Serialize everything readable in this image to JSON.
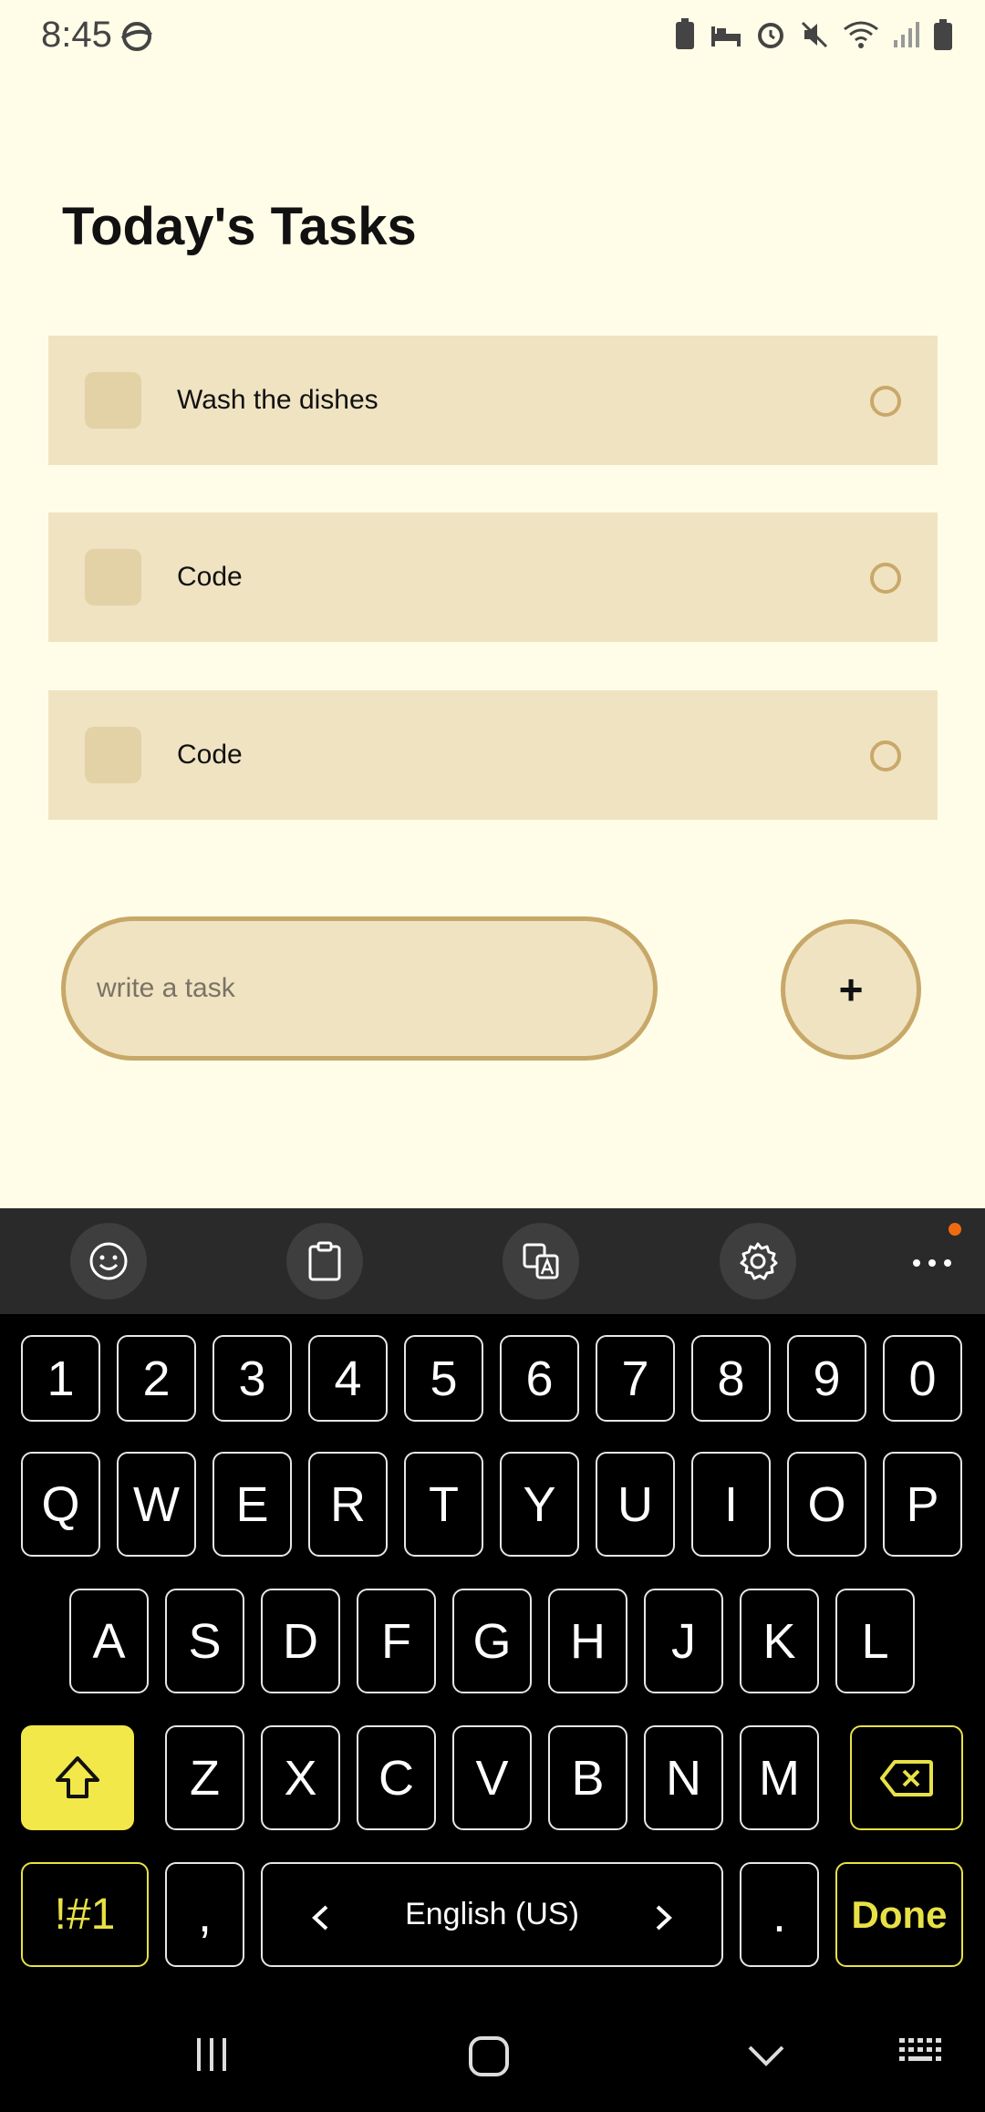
{
  "status": {
    "time": "8:45"
  },
  "title": "Today's Tasks",
  "tasks": [
    {
      "text": "Wash the dishes"
    },
    {
      "text": "Code"
    },
    {
      "text": "Code"
    }
  ],
  "input": {
    "placeholder": "write a task"
  },
  "add_button": {
    "label": "+"
  },
  "keyboard": {
    "number_row": [
      "1",
      "2",
      "3",
      "4",
      "5",
      "6",
      "7",
      "8",
      "9",
      "0"
    ],
    "row1": [
      "Q",
      "W",
      "E",
      "R",
      "T",
      "Y",
      "U",
      "I",
      "O",
      "P"
    ],
    "row2": [
      "A",
      "S",
      "D",
      "F",
      "G",
      "H",
      "J",
      "K",
      "L"
    ],
    "row3": [
      "Z",
      "X",
      "C",
      "V",
      "B",
      "N",
      "M"
    ],
    "symbols_label": "!#1",
    "comma": ",",
    "space_label": "English (US)",
    "period": ".",
    "done_label": "Done"
  },
  "colors": {
    "background": "#FFFDE8",
    "card": "#F0E3C2",
    "accent_border": "#C7A868",
    "keyboard_accent": "#E8E146"
  }
}
